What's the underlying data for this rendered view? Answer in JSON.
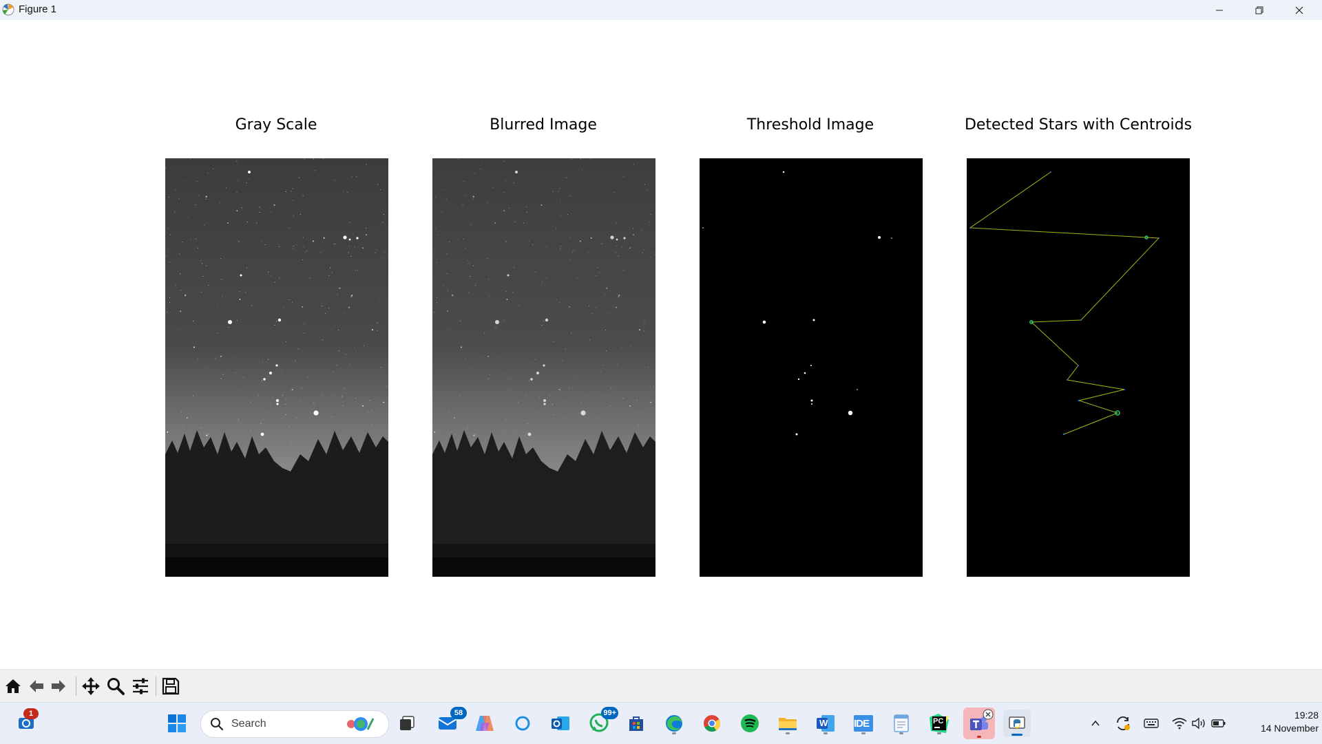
{
  "window": {
    "title": "Figure 1",
    "controls": [
      "minimize",
      "maximize",
      "close"
    ]
  },
  "figure": {
    "subplots": [
      {
        "title": "Gray Scale",
        "content": "grayscale night-sky photo with tree line"
      },
      {
        "title": "Blurred Image",
        "content": "blurred grayscale night-sky photo with tree line"
      },
      {
        "title": "Threshold Image",
        "content": "black background with white thresholded star blobs"
      },
      {
        "title": "Detected Stars with Centroids",
        "content": "black background with centroids connected by yellow-green line"
      }
    ],
    "line_color": "#a8b514",
    "centroid_colors": [
      "#1fd46a",
      "#2a6cf0"
    ]
  },
  "toolbar": {
    "tools": [
      "home-icon",
      "back-icon",
      "forward-icon",
      "pan-icon",
      "zoom-icon",
      "configure-subplots-icon",
      "save-icon"
    ]
  },
  "taskbar": {
    "search_placeholder": "Search",
    "badges": {
      "mail": "58",
      "whatsapp": "99+",
      "outlook_mobile": "1"
    },
    "apps": [
      "start-icon",
      "search-icon",
      "task-view-icon",
      "mail-icon",
      "copilot-icon",
      "cortana-icon",
      "outlook-icon",
      "whatsapp-icon",
      "store-icon",
      "edge-icon",
      "chrome-icon",
      "spotify-icon",
      "file-explorer-icon",
      "word-icon",
      "ide-icon",
      "notepad-icon",
      "pycharm-icon",
      "teams-icon",
      "python-icon"
    ],
    "ide_label": "IDE",
    "pycharm_label": "PC",
    "word_label": "W",
    "clock_time": "19:28",
    "clock_date": "14 November"
  }
}
